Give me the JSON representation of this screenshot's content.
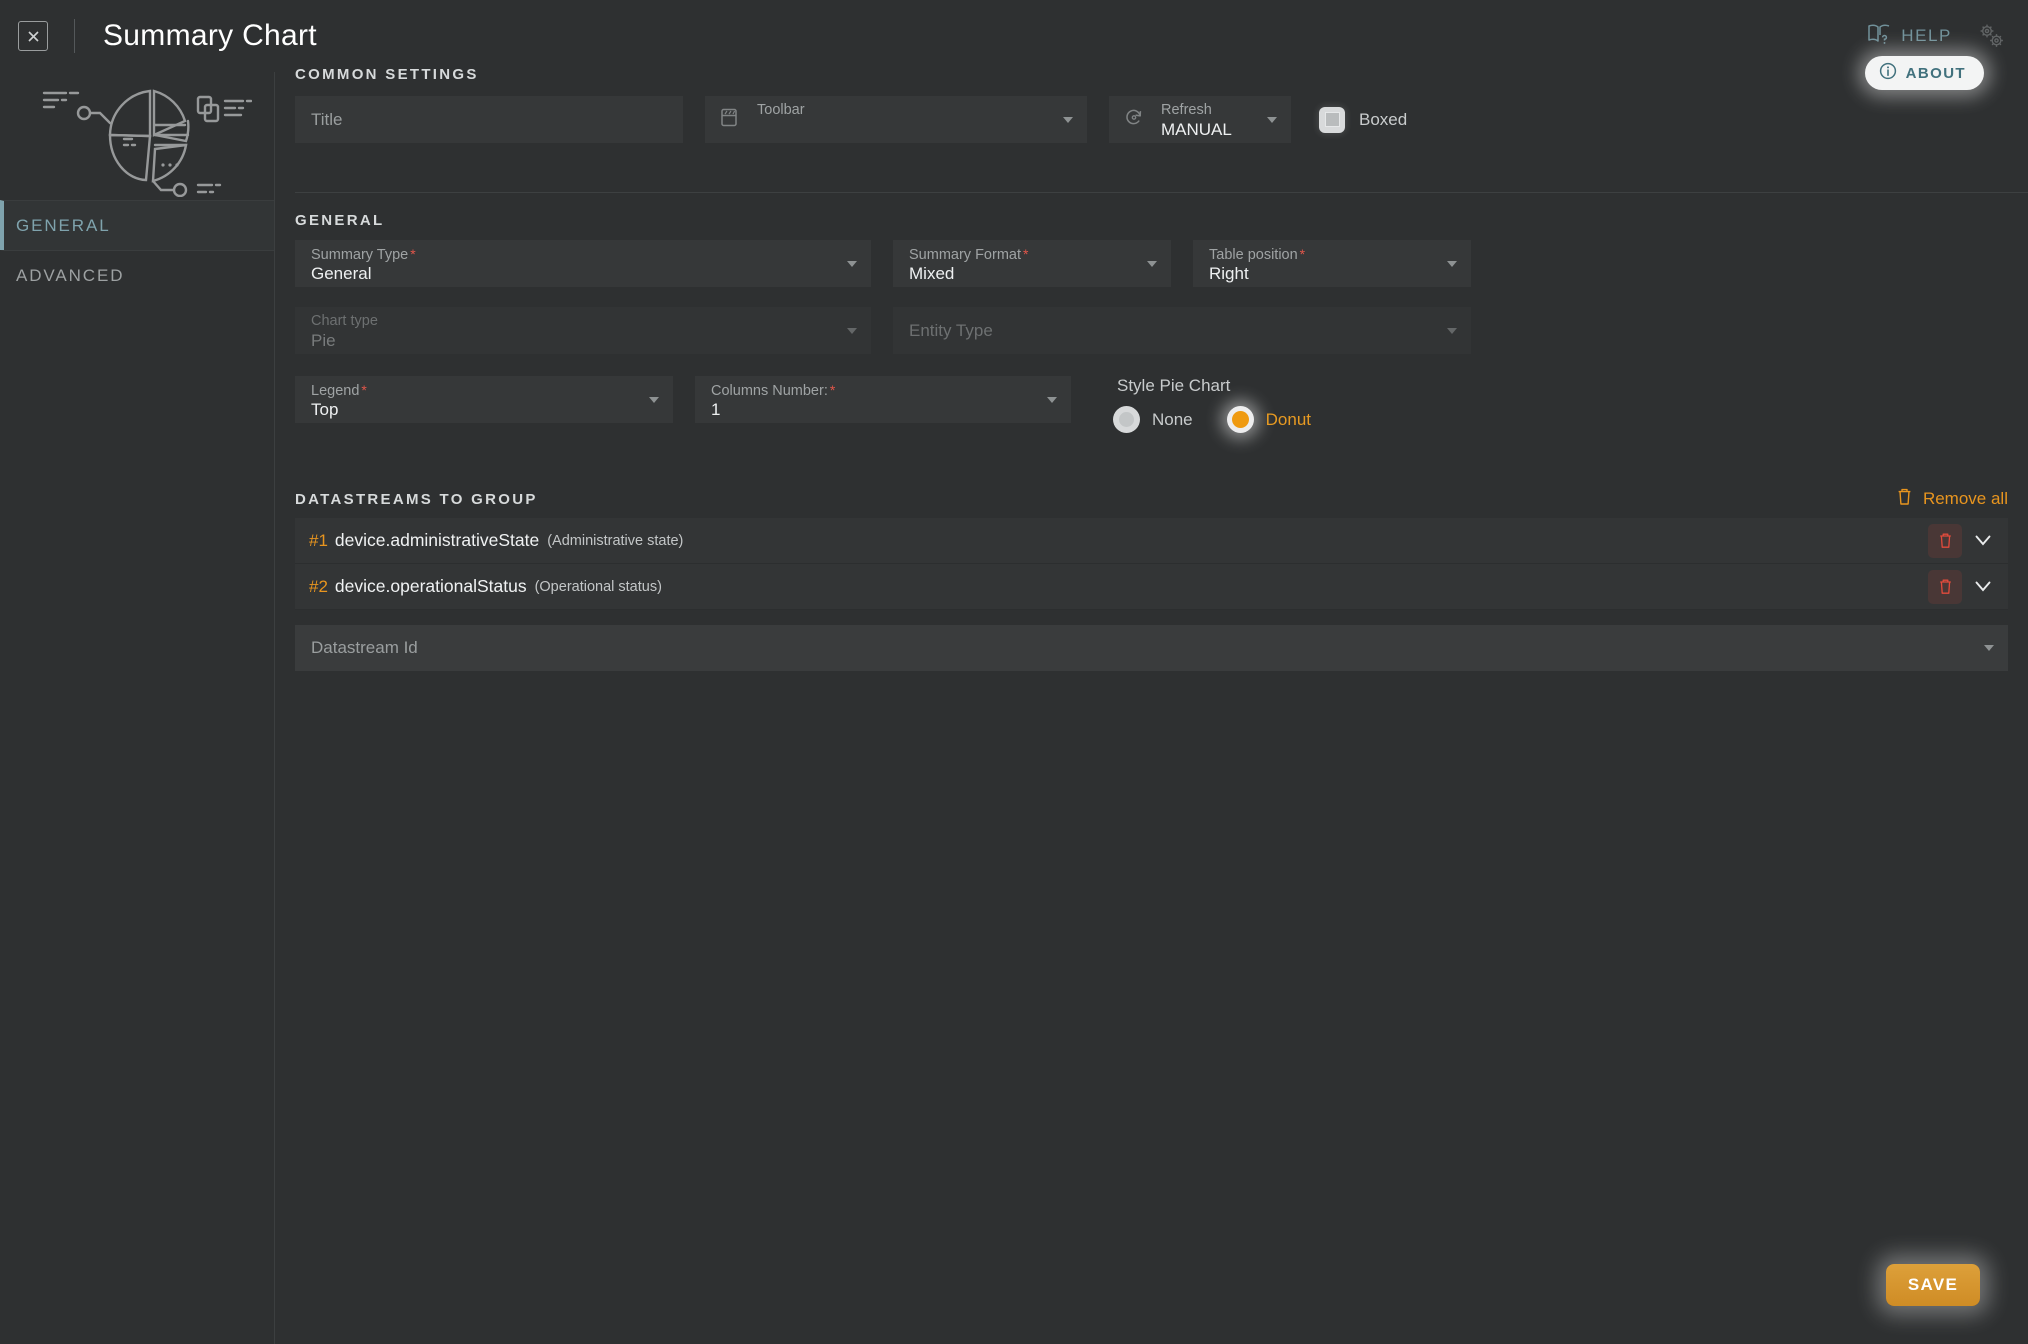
{
  "header": {
    "close_icon": "close-icon",
    "title": "Summary Chart",
    "help_label": "HELP",
    "help_icon": "book-question-icon",
    "settings_icon": "gears-icon"
  },
  "sidebar": {
    "art_icon": "pie-chart-illustration",
    "tabs": [
      {
        "label": "GENERAL",
        "active": true
      },
      {
        "label": "ADVANCED",
        "active": false
      }
    ]
  },
  "about": {
    "label": "ABOUT",
    "icon": "info-circle-icon"
  },
  "common_settings": {
    "heading": "COMMON SETTINGS",
    "title_field": {
      "placeholder": "Title",
      "value": ""
    },
    "toolbar_field": {
      "label": "Toolbar",
      "value": "",
      "icon": "toolbar-window-icon"
    },
    "refresh_field": {
      "label": "Refresh",
      "value": "MANUAL",
      "icon": "refresh-icon"
    },
    "boxed": {
      "label": "Boxed",
      "checked": true
    }
  },
  "general": {
    "heading": "GENERAL",
    "summary_type": {
      "label": "Summary Type",
      "required": "*",
      "value": "General"
    },
    "summary_format": {
      "label": "Summary Format",
      "required": "*",
      "value": "Mixed"
    },
    "table_position": {
      "label": "Table position",
      "required": "*",
      "value": "Right"
    },
    "chart_type": {
      "label": "Chart type",
      "value": "Pie",
      "disabled": true
    },
    "entity_type": {
      "placeholder": "Entity Type",
      "value": "",
      "disabled": true
    },
    "legend": {
      "label": "Legend",
      "required": "*",
      "value": "Top"
    },
    "columns_number": {
      "label": "Columns Number:",
      "required": "*",
      "value": "1"
    },
    "style_pie_chart": {
      "title": "Style Pie Chart",
      "options": [
        {
          "label": "None",
          "selected": false
        },
        {
          "label": "Donut",
          "selected": true
        }
      ]
    }
  },
  "datastreams": {
    "heading": "DATASTREAMS TO GROUP",
    "remove_all_label": "Remove all",
    "remove_all_icon": "trash-icon",
    "rows": [
      {
        "number": "#1",
        "name": "device.administrativeState",
        "description": "(Administrative state)",
        "delete_icon": "trash-icon",
        "expand_icon": "chevron-down-icon"
      },
      {
        "number": "#2",
        "name": "device.operationalStatus",
        "description": "(Operational status)",
        "delete_icon": "trash-icon",
        "expand_icon": "chevron-down-icon"
      }
    ],
    "add_field": {
      "placeholder": "Datastream Id",
      "value": ""
    }
  },
  "footer": {
    "save_label": "SAVE"
  },
  "colors": {
    "background": "#2e3031",
    "field": "#363839",
    "accent_orange": "#e8951f",
    "accent_teal": "#7fa3ad",
    "required_red": "#e2564a",
    "text_primary": "#eef0f1",
    "text_secondary": "#9fa3a4"
  }
}
